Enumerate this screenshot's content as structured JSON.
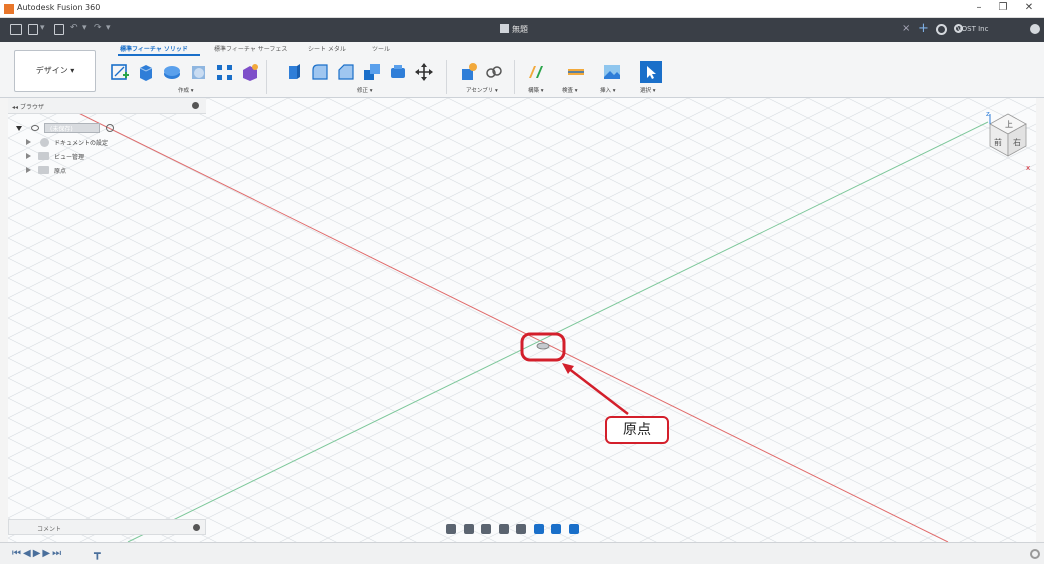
{
  "app": {
    "title": "Autodesk Fusion 360"
  },
  "window_controls": {
    "minimize": "–",
    "maximize": "❐",
    "close": "✕"
  },
  "quickbar": {
    "doc_title": "無題",
    "close_tab": "×",
    "user": "VOST Inc"
  },
  "ribbon": {
    "workspace": "デザイン",
    "tabs": [
      "標準フィーチャ ソリッド",
      "標準フィーチャ サーフェス",
      "シート メタル",
      "ツール"
    ],
    "groups": [
      "作成",
      "修正",
      "アセンブリ",
      "構築",
      "検査",
      "挿入",
      "選択"
    ]
  },
  "browser": {
    "title": "ブラウザ",
    "items": [
      {
        "label": "(未保存)"
      },
      {
        "label": "ドキュメントの設定"
      },
      {
        "label": "ビュー管理"
      },
      {
        "label": "原点"
      }
    ]
  },
  "comments": {
    "label": "コメント"
  },
  "callout": {
    "label": "原点"
  },
  "viewcube": {
    "top": "上",
    "front": "前",
    "right": "右",
    "z": "z",
    "x": "x"
  },
  "colors": {
    "x_axis": "#e06b6b",
    "y_axis": "#7dc79a",
    "accent": "#1a6fc9",
    "highlight": "#d31f2b"
  }
}
